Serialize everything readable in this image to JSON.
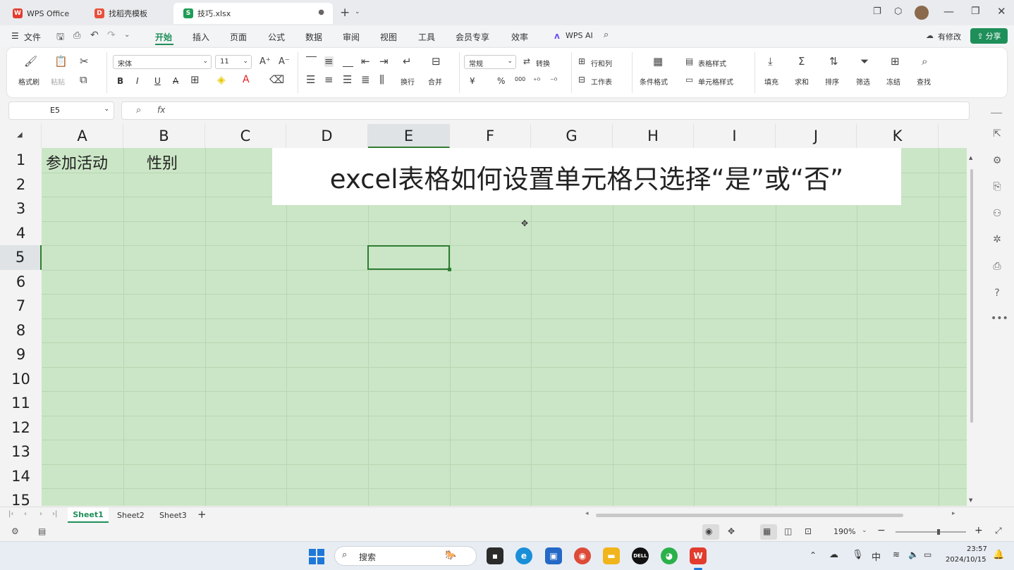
{
  "tabs": [
    {
      "label": "WPS Office",
      "icon": "wps-logo-icon"
    },
    {
      "label": "找稻壳模板",
      "icon": "docer-icon"
    },
    {
      "label": "技巧.xlsx",
      "icon": "sheet-file-icon"
    }
  ],
  "menu": {
    "file": "文件",
    "items": [
      "开始",
      "插入",
      "页面",
      "公式",
      "数据",
      "审阅",
      "视图",
      "工具",
      "会员专享",
      "效率"
    ],
    "wps_ai": "WPS AI",
    "has_changes": "有修改",
    "share": "分享"
  },
  "ribbon": {
    "format_painter": "格式刷",
    "paste": "粘贴",
    "font_name": "宋体",
    "font_size": "11",
    "bold": "B",
    "italic": "I",
    "underline": "U",
    "strike": "A",
    "wrap": "换行",
    "merge": "合并",
    "number_format": "常规",
    "convert": "转换",
    "currency": "¥",
    "percent": "%",
    "thousands": "000",
    "row_col": "行和列",
    "worksheet": "工作表",
    "conditional_format": "条件格式",
    "table_style": "表格样式",
    "cell_style": "单元格样式",
    "fill": "填充",
    "sum": "求和",
    "sort": "排序",
    "filter": "筛选",
    "freeze": "冻结",
    "find": "查找"
  },
  "formula_bar": {
    "cell_ref": "E5",
    "fx": "fx",
    "value": ""
  },
  "columns": [
    "A",
    "B",
    "C",
    "D",
    "E",
    "F",
    "G",
    "H",
    "I",
    "J",
    "K"
  ],
  "rows": [
    "1",
    "2",
    "3",
    "4",
    "5",
    "6",
    "7",
    "8",
    "9",
    "10",
    "11",
    "12",
    "13",
    "14",
    "15"
  ],
  "cells": {
    "A1": "参加活动",
    "B1": "性别"
  },
  "overlay_title": "excel表格如何设置单元格只选择“是”或“否”",
  "sheets": [
    "Sheet1",
    "Sheet2",
    "Sheet3"
  ],
  "status": {
    "zoom": "190%"
  },
  "taskbar": {
    "search": "搜索",
    "ime": "中",
    "time": "23:57",
    "date": "2024/10/15"
  },
  "colors": {
    "accent": "#1f8f5a",
    "cell_bg": "#cbe6c6",
    "selection": "#2e7d32"
  }
}
